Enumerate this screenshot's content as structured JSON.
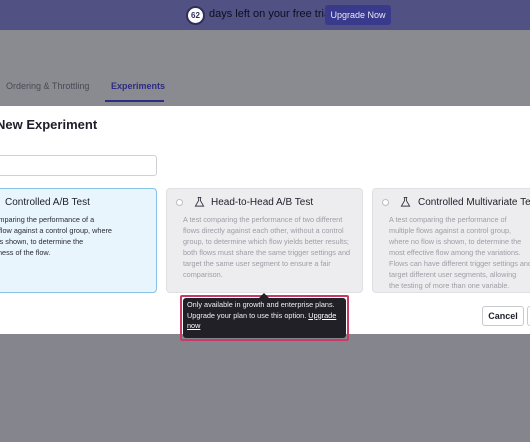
{
  "trial_banner": {
    "days_count": "62",
    "message": "days left on your free trial",
    "upgrade_button": "Upgrade Now"
  },
  "page_tabs": [
    {
      "label": "Ordering & Throttling",
      "active": false
    },
    {
      "label": "Experiments",
      "active": true
    }
  ],
  "modal": {
    "title": "New Experiment",
    "name_input": {
      "value": "",
      "placeholder": ""
    },
    "cards": [
      {
        "title": "Controlled A/B Test",
        "description": "A test comparing the performance of a single flow against a control group, where no flow is shown, to determine the effectiveness of the flow.",
        "description_visible": "st comparing the performance of a\nngle flow against a control group, where\nflow is shown, to determine the\nctiveness of the flow.",
        "selected": true,
        "disabled": false
      },
      {
        "title": "Head-to-Head A/B Test",
        "description": "A test comparing the performance of two different flows directly against each other, without a control group, to determine which flow yields better results; both flows must share the same trigger settings and target the same user segment to ensure a fair comparison.",
        "selected": false,
        "disabled": true
      },
      {
        "title": "Controlled Multivariate Test",
        "description_visible": "A test comparing the performance of\nmultiple flows against a control group,\nwhere no flow is shown, to determine the\nmost effective flow among the variations.\nFlows can have different trigger settings and\ntarget different user segments, allowing\nthe testing of more than one variable.",
        "selected": false,
        "disabled": true
      }
    ],
    "cancel_button": "Cancel"
  },
  "tooltip": {
    "text": "Only available in growth and enterprise plans. Upgrade your plan to use this option.",
    "link": "Upgrade now"
  },
  "icons": [
    "flask-icon",
    "radio-icon"
  ],
  "colors": {
    "banner_bg": "#515184",
    "upgrade_button": "#3a3a8c",
    "selected_card_bg": "#e9f5fc",
    "selected_card_border": "#86c3e7",
    "tooltip_bg": "#202026",
    "highlight_border": "#c93a64"
  }
}
